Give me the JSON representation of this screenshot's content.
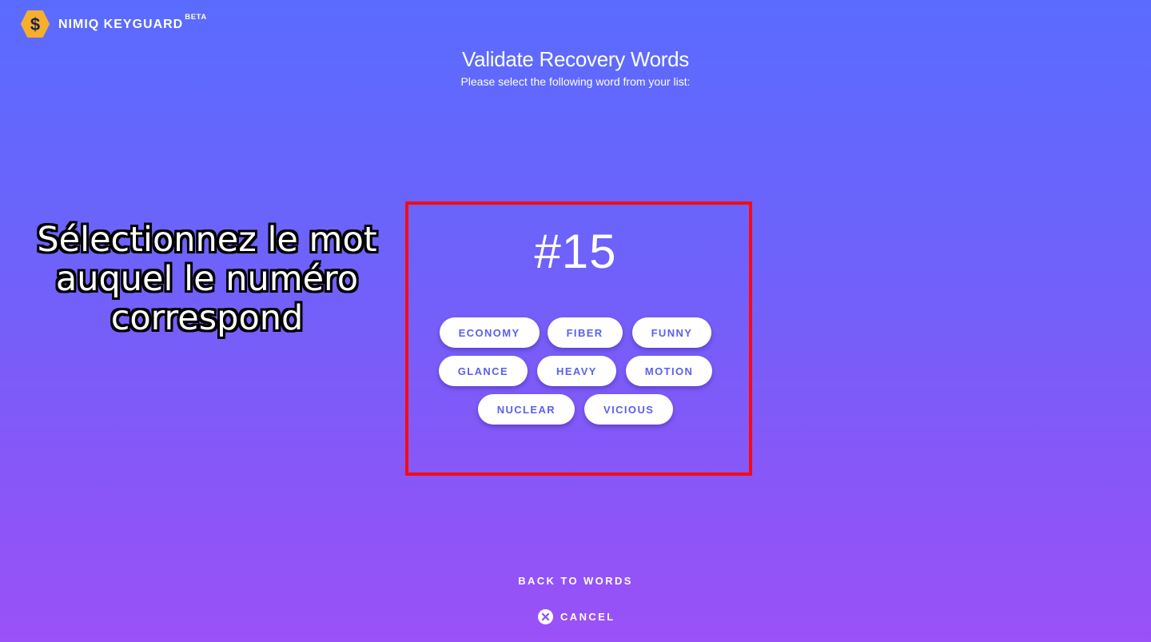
{
  "header": {
    "brand_name": "NIMIQ KEYGUARD",
    "brand_badge": "BETA",
    "logo_icon": "nimiq-hexagon-dollar-icon",
    "logo_color": "#f6ae2d"
  },
  "main": {
    "title": "Validate Recovery Words",
    "subtitle": "Please select the following word from your list:",
    "word_number": "#15",
    "words": [
      "ECONOMY",
      "FIBER",
      "FUNNY",
      "GLANCE",
      "HEAVY",
      "MOTION",
      "NUCLEAR",
      "VICIOUS"
    ]
  },
  "annotation": {
    "caption": "Sélectionnez le mot\nauquel le numéro\ncorrespond",
    "highlight_color": "#f70a14"
  },
  "footer": {
    "back_label": "BACK TO WORDS",
    "cancel_label": "CANCEL",
    "cancel_icon": "close-circle-icon"
  },
  "colors": {
    "gradient_top": "#5a6cff",
    "gradient_bottom": "#9a51f7",
    "button_text": "#5a60f0"
  }
}
